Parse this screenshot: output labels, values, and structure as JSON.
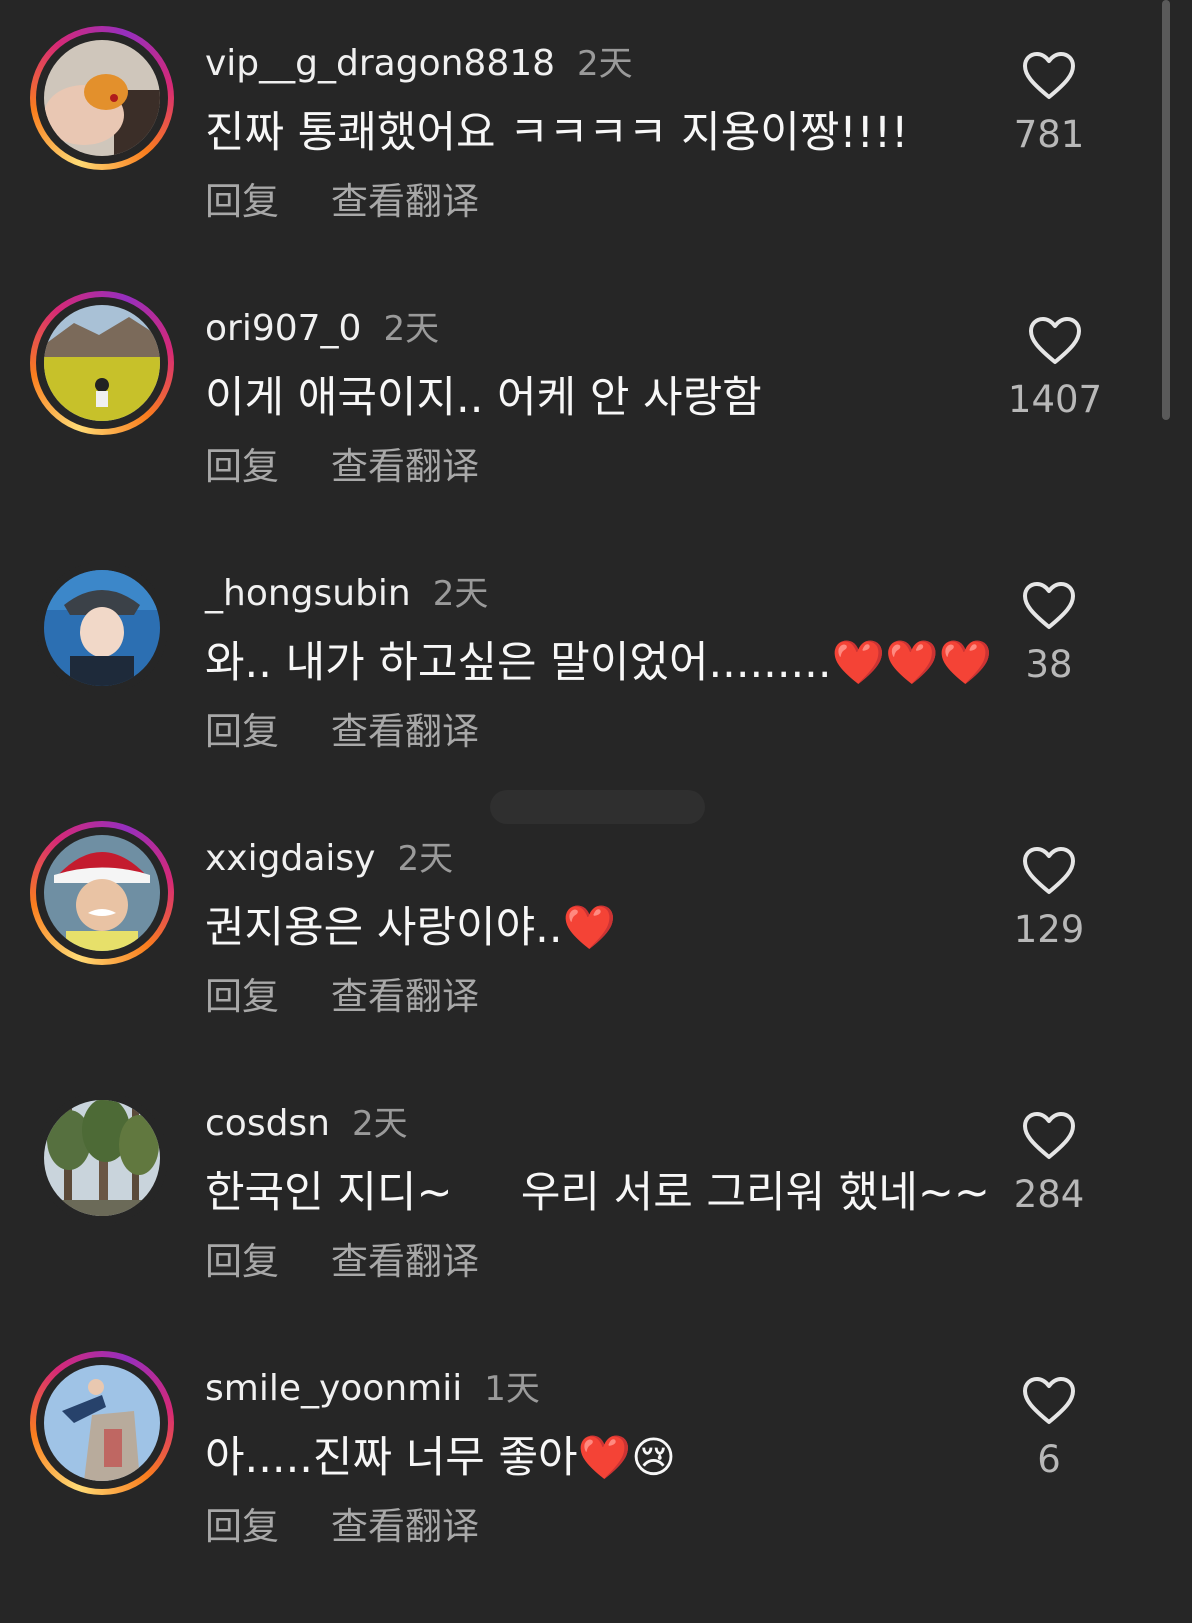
{
  "actions": {
    "reply_label": "回复",
    "translate_label": "查看翻译"
  },
  "comments": [
    {
      "username": "vip__g_dragon8818",
      "time": "2天",
      "text": "진짜 통쾌했어요 ㅋㅋㅋㅋ 지용이짱!!!!",
      "likes": "781",
      "story_ring": true
    },
    {
      "username": "ori907_0",
      "time": "2天",
      "text": "이게 애국이지.. 어케 안 사랑함",
      "likes": "1407",
      "story_ring": true
    },
    {
      "username": "_hongsubin",
      "time": "2天",
      "text": "와.. 내가 하고싶은 말이었어.........❤️❤️❤️",
      "likes": "38",
      "story_ring": false
    },
    {
      "username": "xxigdaisy",
      "time": "2天",
      "text": "권지용은 사랑이야..❤️",
      "likes": "129",
      "story_ring": true
    },
    {
      "username": "cosdsn",
      "time": "2天",
      "text": "한국인 지디~     우리 서로 그리워 했네~~",
      "likes": "284",
      "story_ring": false
    },
    {
      "username": "smile_yoonmii",
      "time": "1天",
      "text": "아.....진짜 너무 좋아❤️😢",
      "likes": "6",
      "story_ring": true
    }
  ],
  "colors": {
    "background": "#262626",
    "story_ring": "#d62976"
  },
  "icons": {
    "like": "heart-outline-icon"
  }
}
